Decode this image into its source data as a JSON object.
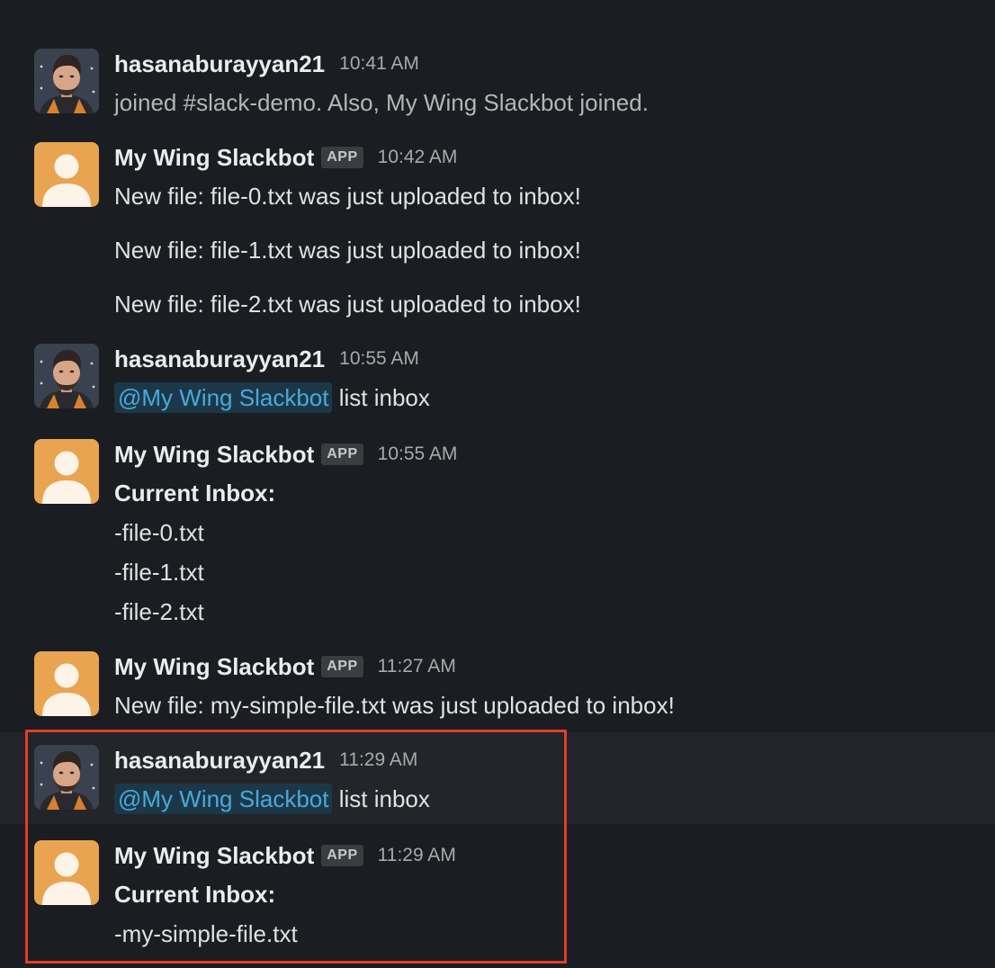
{
  "colors": {
    "background": "#1a1d21",
    "hover_row": "#222529",
    "mention_text": "#4aa8dc",
    "mention_bg": "#1c3848",
    "highlight_border": "#e23d28",
    "bot_avatar": "#e8a451"
  },
  "messages": [
    {
      "author": "hasanaburayyan21",
      "time": "10:41 AM",
      "avatar": "user-portrait",
      "lines": [
        "joined #slack-demo. Also, My Wing Slackbot joined."
      ]
    },
    {
      "author": "My Wing Slackbot",
      "badge": "APP",
      "time": "10:42 AM",
      "avatar": "default-user-avatar",
      "lines": [
        "New file: file-0.txt was just uploaded to inbox!",
        "New file: file-1.txt was just uploaded to inbox!",
        "New file: file-2.txt was just uploaded to inbox!"
      ]
    },
    {
      "author": "hasanaburayyan21",
      "time": "10:55 AM",
      "avatar": "user-portrait",
      "mention": "@My Wing Slackbot",
      "text": "list inbox"
    },
    {
      "author": "My Wing Slackbot",
      "badge": "APP",
      "time": "10:55 AM",
      "avatar": "default-user-avatar",
      "heading": "Current Inbox:",
      "lines": [
        "-file-0.txt",
        "-file-1.txt",
        "-file-2.txt"
      ]
    },
    {
      "author": "My Wing Slackbot",
      "badge": "APP",
      "time": "11:27 AM",
      "avatar": "default-user-avatar",
      "lines": [
        "New file: my-simple-file.txt was just uploaded to inbox!"
      ]
    },
    {
      "author": "hasanaburayyan21",
      "time": "11:29 AM",
      "avatar": "user-portrait",
      "mention": "@My Wing Slackbot",
      "text": "list inbox"
    },
    {
      "author": "My Wing Slackbot",
      "badge": "APP",
      "time": "11:29 AM",
      "avatar": "default-user-avatar",
      "heading": "Current Inbox:",
      "lines": [
        "-my-simple-file.txt"
      ]
    }
  ]
}
